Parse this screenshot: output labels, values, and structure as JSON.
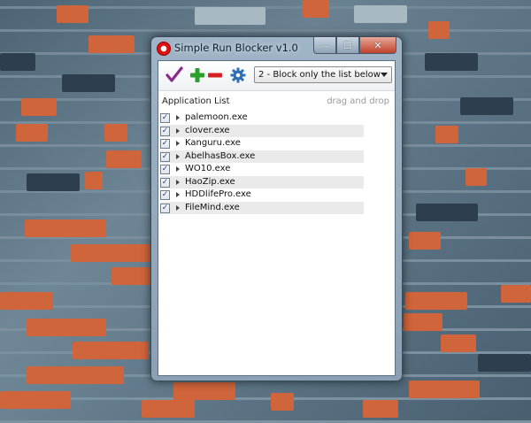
{
  "window": {
    "title": "Simple Run Blocker v1.0",
    "controls": {
      "minimize": "—",
      "maximize": "☐",
      "close": "✕"
    }
  },
  "toolbar": {
    "apply_icon": "checkmark-icon",
    "add_icon": "plus-icon",
    "remove_icon": "minus-icon",
    "settings_icon": "gear-icon",
    "mode_selected": "2 - Block only the list below"
  },
  "list": {
    "header": "Application List",
    "hint": "drag and drop",
    "items": [
      {
        "name": "palemoon.exe",
        "checked": true
      },
      {
        "name": "clover.exe",
        "checked": true
      },
      {
        "name": "Kanguru.exe",
        "checked": true
      },
      {
        "name": "AbelhasBox.exe",
        "checked": true
      },
      {
        "name": "WO10.exe",
        "checked": true
      },
      {
        "name": "HaoZip.exe",
        "checked": true
      },
      {
        "name": "HDDlifePro.exe",
        "checked": true
      },
      {
        "name": "FileMind.exe",
        "checked": true
      }
    ]
  },
  "colors": {
    "apply": "#8a2c8e",
    "add": "#2aa02a",
    "remove": "#d42020",
    "settings": "#2f6fb5"
  }
}
